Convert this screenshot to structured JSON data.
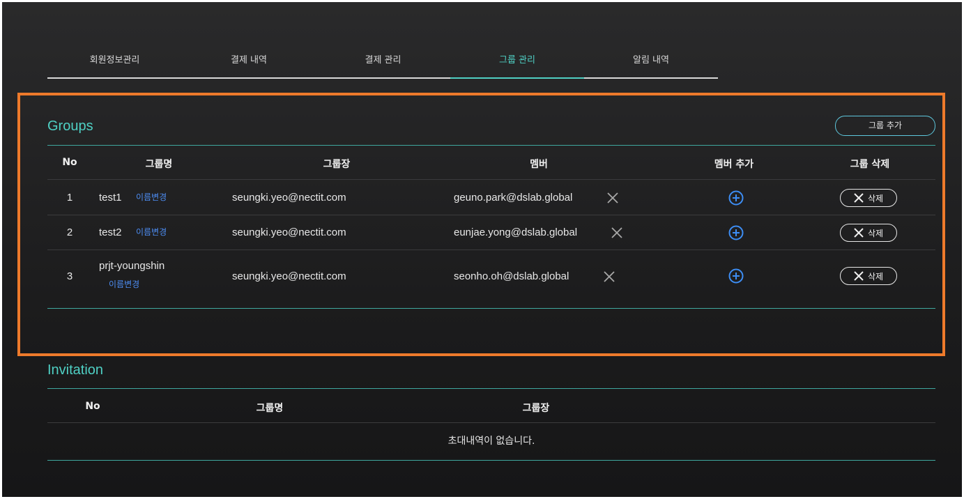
{
  "tabs": [
    {
      "label": "회원정보관리",
      "active": false
    },
    {
      "label": "결제 내역",
      "active": false
    },
    {
      "label": "결제 관리",
      "active": false
    },
    {
      "label": "그룹 관리",
      "active": true
    },
    {
      "label": "알림 내역",
      "active": false
    }
  ],
  "groups": {
    "title": "Groups",
    "add_button": "그룹 추가",
    "headers": {
      "no": "No",
      "name": "그룹명",
      "leader": "그룹장",
      "member": "멤버",
      "add_member": "멤버 추가",
      "delete_group": "그룹 삭제"
    },
    "rename_label": "이름변경",
    "delete_label": "삭제",
    "rows": [
      {
        "no": "1",
        "name": "test1",
        "leader": "seungki.yeo@nectit.com",
        "member": "geuno.park@dslab.global"
      },
      {
        "no": "2",
        "name": "test2",
        "leader": "seungki.yeo@nectit.com",
        "member": "eunjae.yong@dslab.global"
      },
      {
        "no": "3",
        "name": "prjt-youngshin",
        "leader": "seungki.yeo@nectit.com",
        "member": "seonho.oh@dslab.global"
      }
    ]
  },
  "invitation": {
    "title": "Invitation",
    "headers": {
      "no": "No",
      "name": "그룹명",
      "leader": "그룹장"
    },
    "empty_message": "초대내역이 없습니다."
  },
  "colors": {
    "accent": "#4fd0c4",
    "link": "#4d8ef5",
    "highlight": "#ee7a2b",
    "add_icon": "#3d8ef5"
  }
}
